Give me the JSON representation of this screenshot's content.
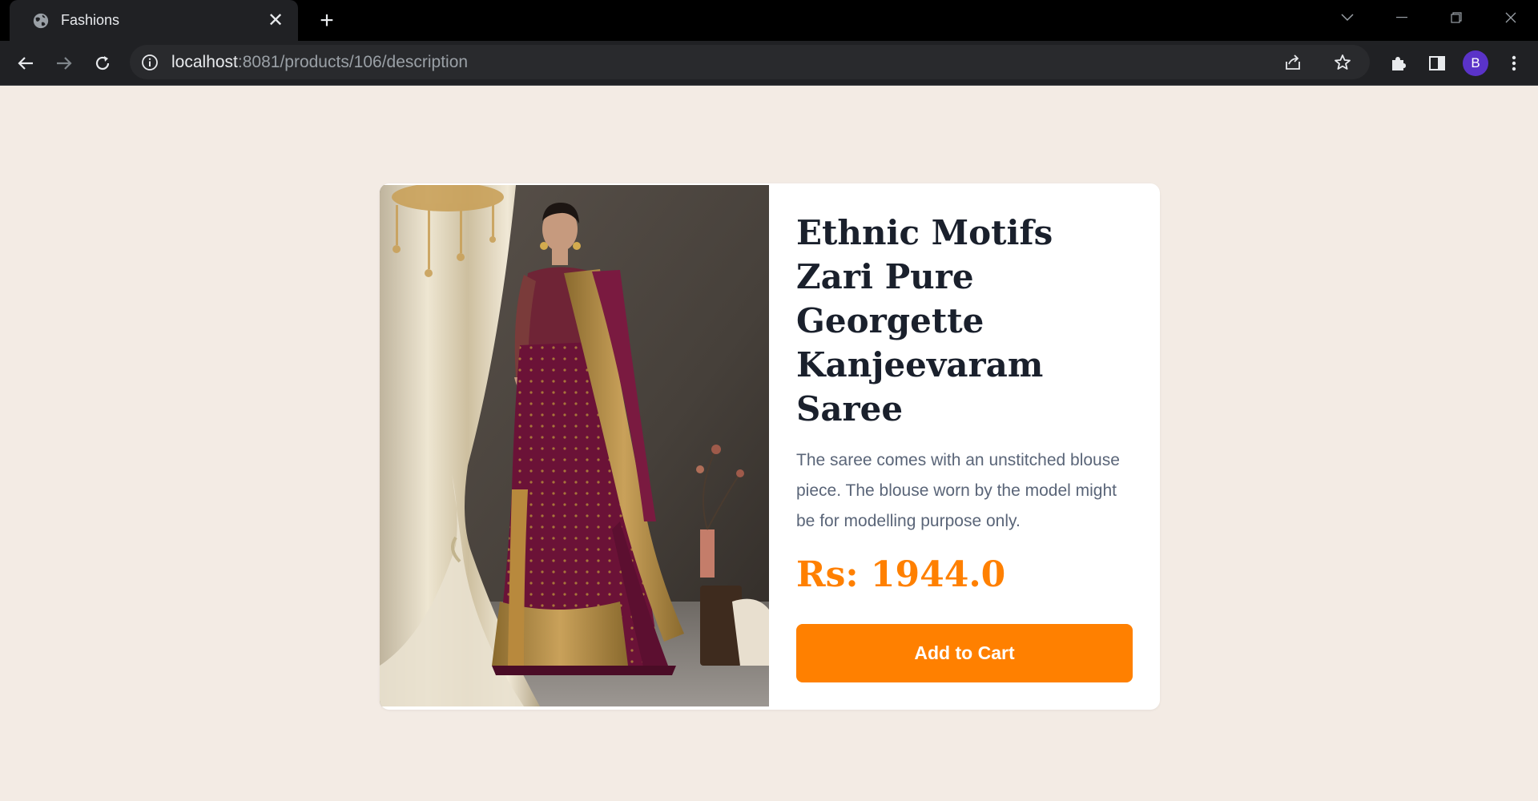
{
  "browser": {
    "tab_title": "Fashions",
    "tab_close": "✕",
    "new_tab": "+",
    "url_host": "localhost",
    "url_rest": ":8081/products/106/description",
    "profile_initial": "B"
  },
  "product": {
    "title": "Ethnic Motifs Zari Pure Georgette Kanjeevaram Saree",
    "description": "The saree comes with an unstitched blouse piece. The blouse worn by the model might be for modelling purpose only.",
    "price": "Rs: 1944.0",
    "add_to_cart_label": "Add to Cart"
  },
  "colors": {
    "accent": "#ff8000",
    "page_bg": "#f3ebe4",
    "title": "#1a202c",
    "saree": "#6b1237",
    "border_gold": "#b8893d"
  }
}
